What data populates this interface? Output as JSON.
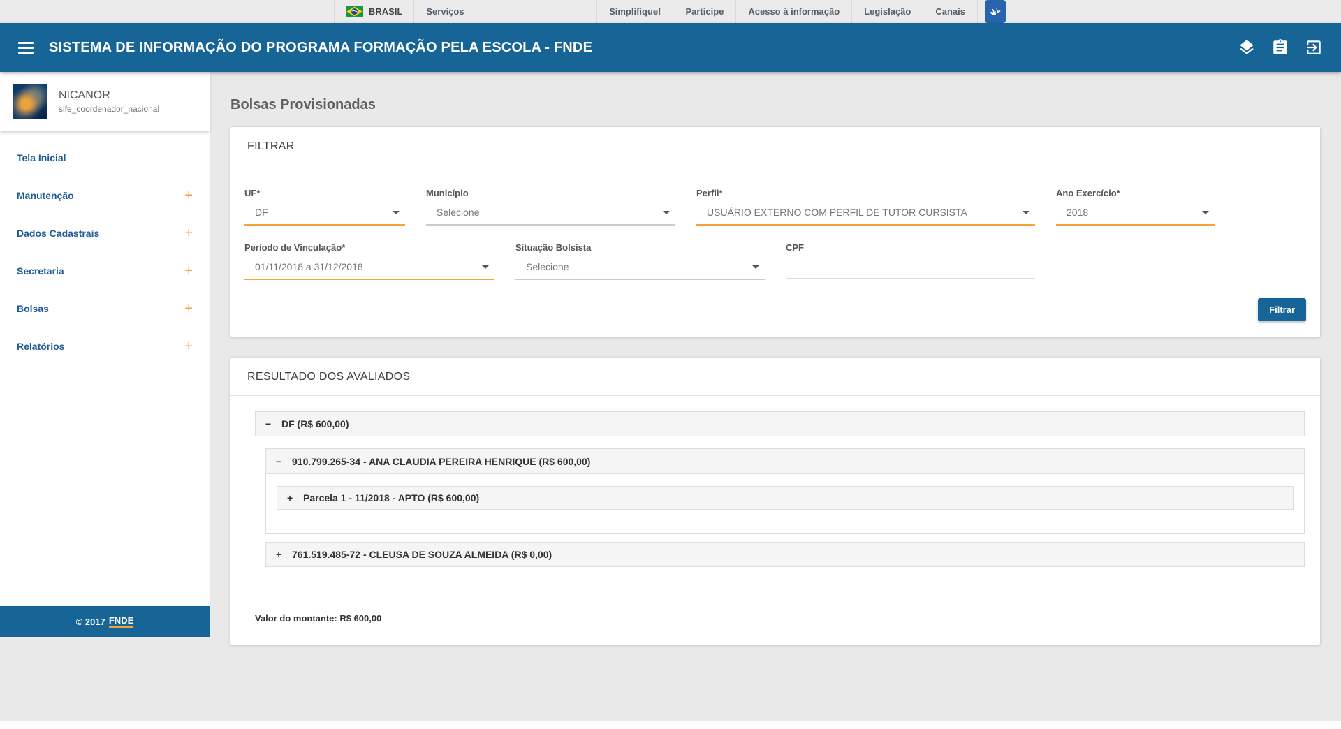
{
  "colors": {
    "accent_blue": "#176496",
    "accent_orange": "#f5a33c"
  },
  "gov_bar": {
    "brand": "BRASIL",
    "services": "Serviços",
    "links": [
      "Simplifique!",
      "Participe",
      "Acesso à informação",
      "Legislação",
      "Canais"
    ],
    "accessibility_icon": "vlibras-hands-icon"
  },
  "header": {
    "title": "SISTEMA DE INFORMAÇÃO DO PROGRAMA FORMAÇÃO PELA ESCOLA - FNDE",
    "icons": [
      "layers-icon",
      "clipboard-icon",
      "logout-icon"
    ]
  },
  "sidebar": {
    "user": {
      "name": "NICANOR",
      "role": "sife_coordenador_nacional"
    },
    "items": [
      {
        "label": "Tela Inicial",
        "expand_glyph": ""
      },
      {
        "label": "Manutenção",
        "expand_glyph": "+"
      },
      {
        "label": "Dados Cadastrais",
        "expand_glyph": "+"
      },
      {
        "label": "Secretaria",
        "expand_glyph": "+"
      },
      {
        "label": "Bolsas",
        "expand_glyph": "+"
      },
      {
        "label": "Relatórios",
        "expand_glyph": "+"
      }
    ],
    "footer": {
      "copyright": "© 2017",
      "link": "FNDE"
    }
  },
  "main": {
    "page_title": "Bolsas Provisionadas",
    "filter": {
      "title": "FILTRAR",
      "fields": {
        "uf": {
          "label": "UF*",
          "value": "DF"
        },
        "municipio": {
          "label": "Município",
          "placeholder": "Selecione"
        },
        "perfil": {
          "label": "Perfil*",
          "value": "USUÁRIO EXTERNO COM PERFIL DE TUTOR CURSISTA"
        },
        "ano": {
          "label": "Ano Exercício*",
          "value": "2018"
        },
        "periodo": {
          "label": "Período de Vinculação*",
          "value": "01/11/2018 a 31/12/2018"
        },
        "situacao": {
          "label": "Situação Bolsista",
          "placeholder": "Selecione"
        },
        "cpf": {
          "label": "CPF",
          "value": ""
        }
      },
      "submit_label": "Filtrar"
    },
    "results": {
      "title": "RESULTADO DOS AVALIADOS",
      "tree": {
        "uf_node": {
          "toggle": "−",
          "label": "DF (R$ 600,00)"
        },
        "person1": {
          "toggle": "−",
          "label": "910.799.265-34 - ANA CLAUDIA PEREIRA HENRIQUE (R$ 600,00)"
        },
        "person1_parcela": {
          "toggle": "+",
          "label": "Parcela 1 - 11/2018 - APTO (R$ 600,00)"
        },
        "person2": {
          "toggle": "+",
          "label": "761.519.485-72 - CLEUSA DE SOUZA ALMEIDA (R$ 0,00)"
        }
      },
      "total_line": "Valor do montante: R$ 600,00"
    }
  }
}
